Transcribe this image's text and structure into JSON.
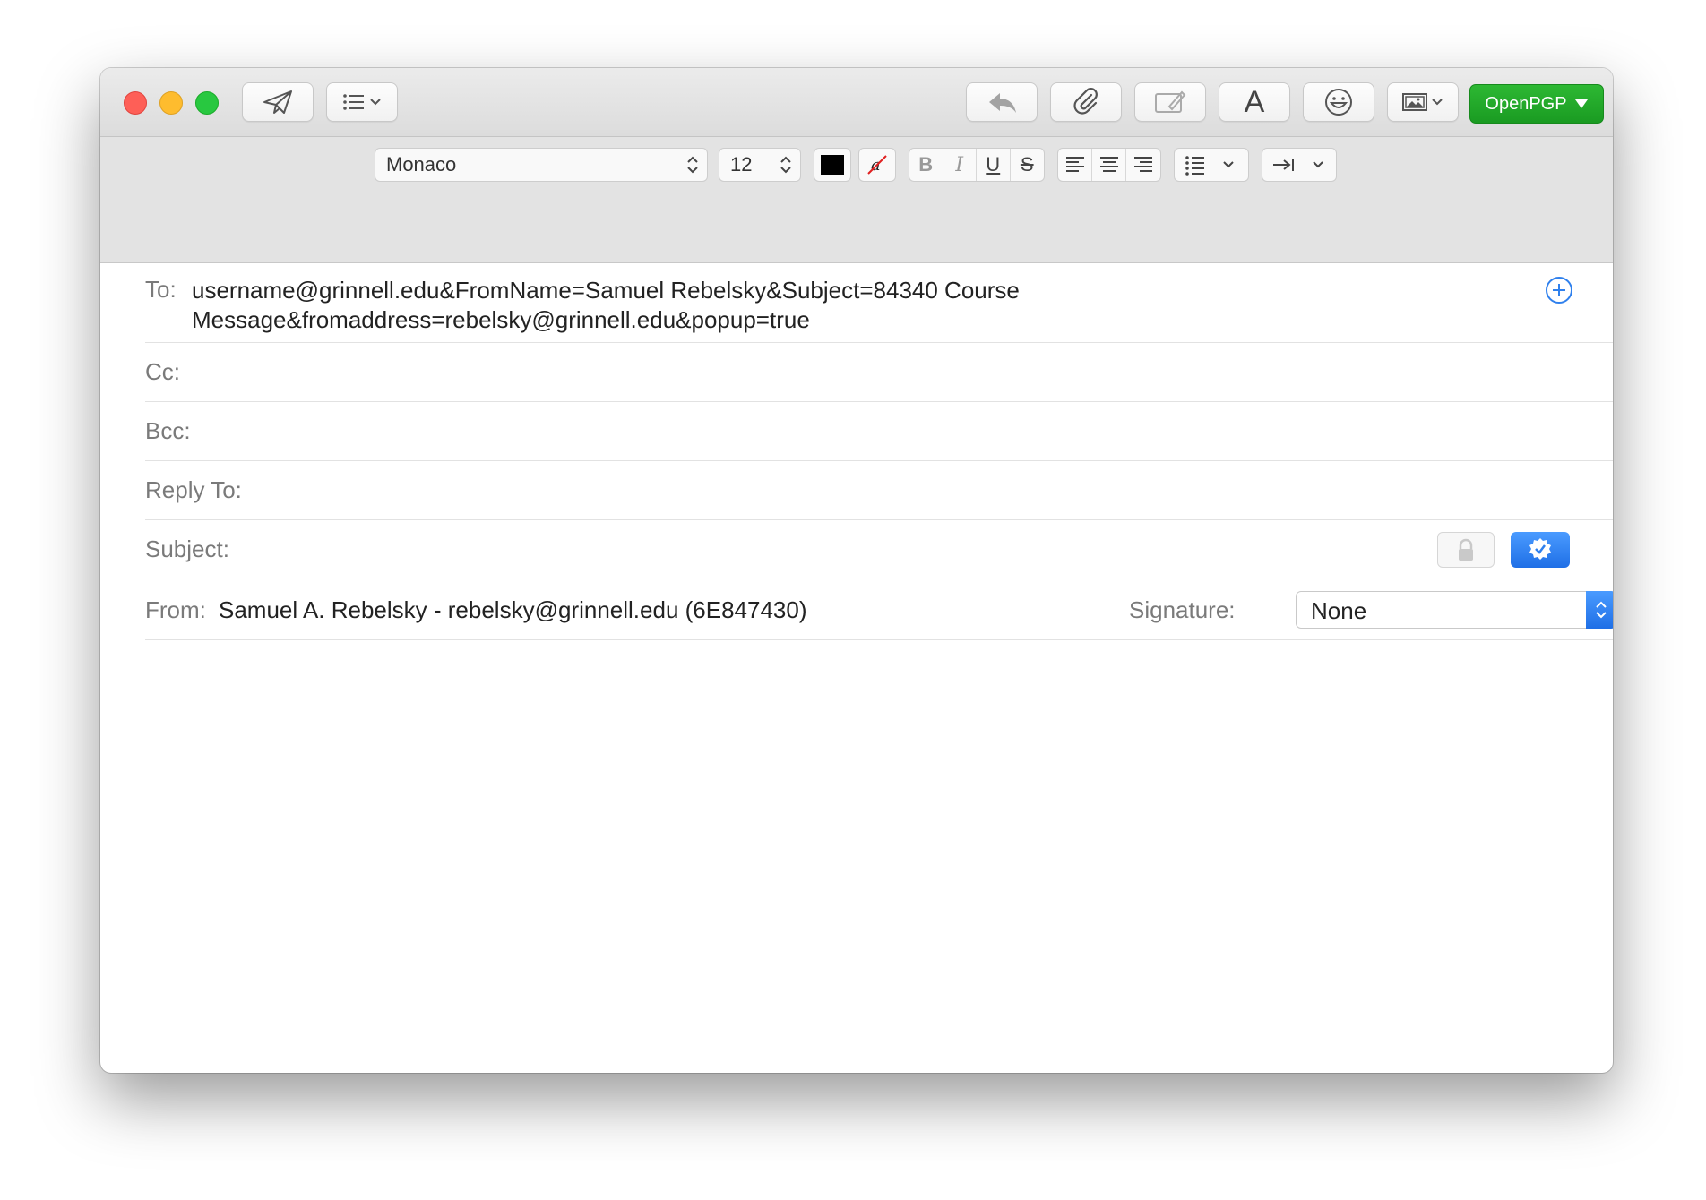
{
  "window": {
    "toolbar": {
      "send_icon": "paper-plane-icon",
      "header_fields_icon": "list-icon",
      "reply_icon": "reply-arrow-icon",
      "attach_icon": "paperclip-icon",
      "markup_icon": "markup-icon",
      "fonts_label": "A",
      "emoji_icon": "smiley-icon",
      "photo_icon": "photo-browser-icon",
      "openpgp_label": "OpenPGP"
    },
    "format": {
      "font_name": "Monaco",
      "font_size": "12",
      "text_color": "#000000",
      "bold": "B",
      "italic": "I",
      "underline": "U",
      "strike": "S"
    },
    "fields": {
      "to_label": "To:",
      "to_value_line1": "username@grinnell.edu&FromName=Samuel Rebelsky&Subject=84340 Course",
      "to_value_line2": "Message&fromaddress=rebelsky@grinnell.edu&popup=true",
      "cc_label": "Cc:",
      "bcc_label": "Bcc:",
      "reply_to_label": "Reply To:",
      "subject_label": "Subject:",
      "from_label": "From:",
      "from_value": "Samuel A. Rebelsky - rebelsky@grinnell.edu (6E847430)",
      "signature_label": "Signature:",
      "signature_value": "None"
    },
    "colors": {
      "openpgp_green": "#1fa526",
      "accent_blue": "#2f80ed",
      "close": "#fe5f57",
      "minimize": "#febc2e",
      "zoom": "#28c840"
    }
  }
}
